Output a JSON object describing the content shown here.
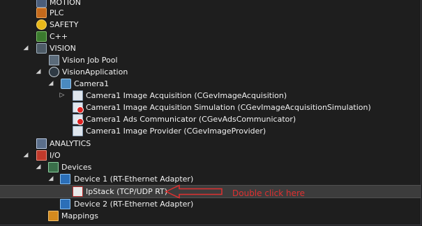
{
  "tree": {
    "items": [
      {
        "label": "MOTION",
        "icon": "motion-icon"
      },
      {
        "label": "PLC",
        "icon": "plc-icon"
      },
      {
        "label": "SAFETY",
        "icon": "safety-icon"
      },
      {
        "label": "C++",
        "icon": "cpp-icon"
      },
      {
        "label": "VISION",
        "icon": "vision-icon",
        "expanded": true
      },
      {
        "label": "Vision Job Pool",
        "icon": "job-pool-icon"
      },
      {
        "label": "VisionApplication",
        "icon": "vision-application-icon",
        "expanded": true
      },
      {
        "label": "Camera1",
        "icon": "camera-icon",
        "expanded": true
      },
      {
        "label": "Camera1 Image Acquisition (CGevImageAcquisition)",
        "icon": "module-icon",
        "expanded": false
      },
      {
        "label": "Camera1 Image Acquisition Simulation (CGevImageAcquisitionSimulation)",
        "icon": "module-disabled-icon"
      },
      {
        "label": "Camera1 Ads Communicator (CGevAdsCommunicator)",
        "icon": "module-disabled-icon"
      },
      {
        "label": "Camera1 Image Provider (CGevImageProvider)",
        "icon": "module-icon"
      },
      {
        "label": "ANALYTICS",
        "icon": "analytics-icon"
      },
      {
        "label": "I/O",
        "icon": "io-icon",
        "expanded": true
      },
      {
        "label": "Devices",
        "icon": "devices-icon",
        "expanded": true
      },
      {
        "label": "Device 1 (RT-Ethernet Adapter)",
        "icon": "device-icon",
        "expanded": true
      },
      {
        "label": "IpStack (TCP/UDP RT)",
        "icon": "ipstack-icon",
        "selected": true
      },
      {
        "label": "Device 2 (RT-Ethernet Adapter)",
        "icon": "device-icon"
      },
      {
        "label": "Mappings",
        "icon": "mappings-icon"
      }
    ]
  },
  "annotation": {
    "text": "Double click here",
    "color": "#e03030"
  },
  "colors": {
    "background": "#1e1e1e",
    "text": "#f1f1f1",
    "selection": "#3c3c3c",
    "annotation": "#e03030"
  }
}
